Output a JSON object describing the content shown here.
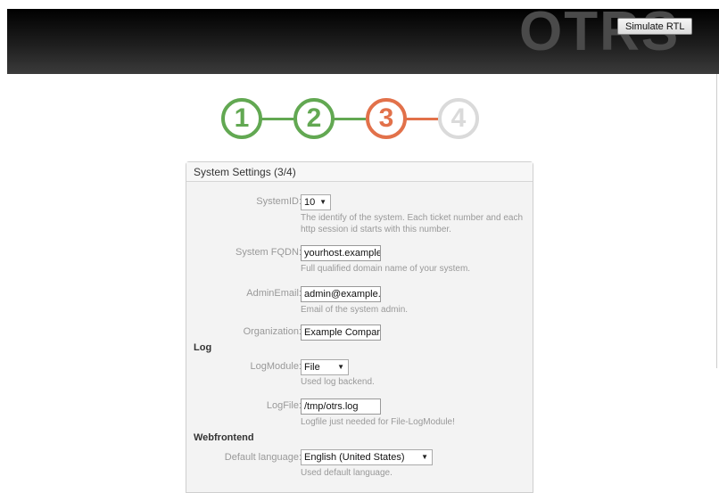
{
  "header": {
    "logo": "OTRS",
    "simulate_rtl": "Simulate RTL"
  },
  "steps": [
    "1",
    "2",
    "3",
    "4"
  ],
  "colors": {
    "done": "#62a852",
    "current": "#e2714a",
    "pending": "#dadada"
  },
  "panel": {
    "title": "System Settings (3/4)",
    "system_id": {
      "label": "SystemID:",
      "value": "10",
      "hint": "The identify of the system. Each ticket number and each http session id starts with this number."
    },
    "fqdn": {
      "label": "System FQDN:",
      "value": "yourhost.example.c",
      "hint": "Full qualified domain name of your system."
    },
    "admin_email": {
      "label": "AdminEmail:",
      "value": "admin@example.c",
      "hint": "Email of the system admin."
    },
    "organization": {
      "label": "Organization:",
      "value": "Example Company"
    },
    "log_section": "Log",
    "log_module": {
      "label": "LogModule:",
      "value": "File",
      "hint": "Used log backend."
    },
    "log_file": {
      "label": "LogFile:",
      "value": "/tmp/otrs.log",
      "hint": "Logfile just needed for File-LogModule!"
    },
    "web_section": "Webfrontend",
    "default_language": {
      "label": "Default language:",
      "value": "English (United States)",
      "hint": "Used default language."
    }
  }
}
